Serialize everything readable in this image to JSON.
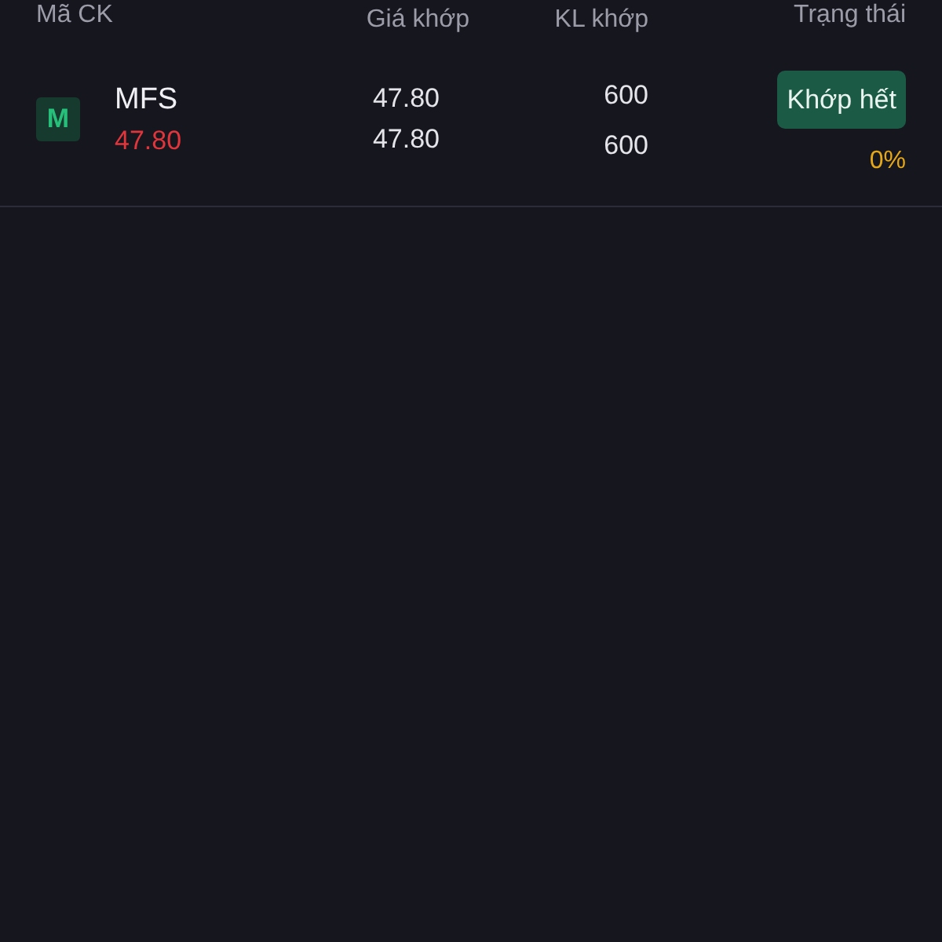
{
  "table": {
    "columns": [
      {
        "label": "Mã CK"
      },
      {
        "label": "Giá khớp"
      },
      {
        "label": "KL khớp"
      },
      {
        "label": "Trạng thái"
      }
    ],
    "rows": [
      {
        "logo_letter": "M",
        "symbol": "MFS",
        "symbol_price": "47.80",
        "price_lines": [
          "47.80",
          "47.80"
        ],
        "volume_lines": [
          "600",
          "600"
        ],
        "status": "Khớp hết",
        "percent": "0%"
      }
    ]
  }
}
